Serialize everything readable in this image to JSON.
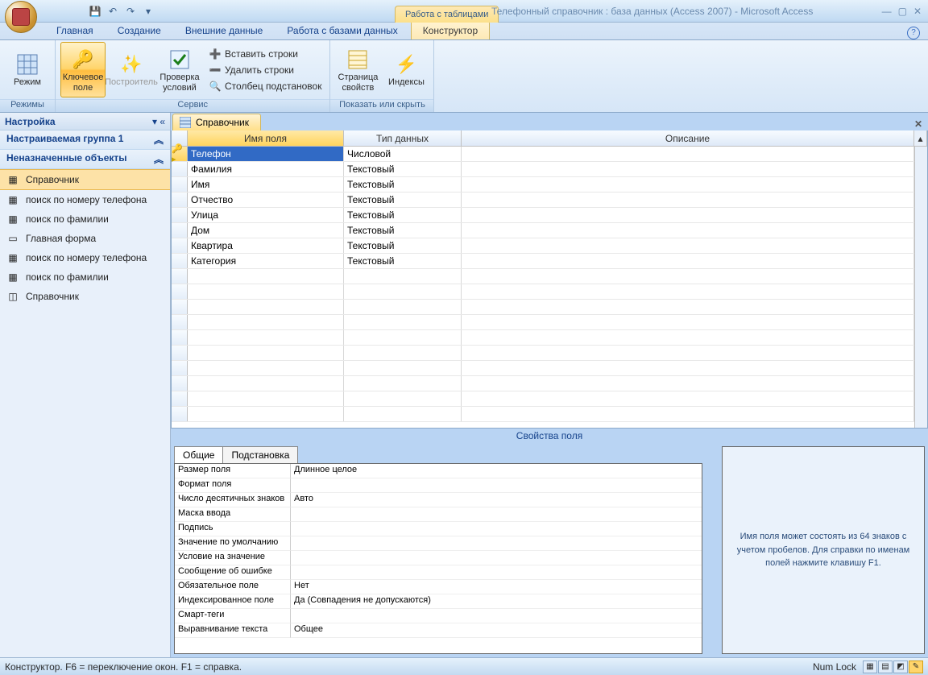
{
  "title": "Телефонный справочник : база данных (Access 2007) - Microsoft Access",
  "context_tab": "Работа с таблицами",
  "ribbon_tabs": [
    "Главная",
    "Создание",
    "Внешние данные",
    "Работа с базами данных",
    "Конструктор"
  ],
  "ribbon_active": "Конструктор",
  "ribbon": {
    "g1": {
      "label": "Режимы",
      "mode": "Режим"
    },
    "g2": {
      "label": "Сервис",
      "key": "Ключевое поле",
      "builder": "Построитель",
      "check": "Проверка условий",
      "ins": "Вставить строки",
      "del": "Удалить строки",
      "col": "Столбец подстановок"
    },
    "g3": {
      "label": "Показать или скрыть",
      "propsheet": "Страница свойств",
      "indexes": "Индексы"
    }
  },
  "nav": {
    "title": "Настройка",
    "grp1": "Настраиваемая группа 1",
    "grp2": "Неназначенные объекты",
    "items": [
      "Справочник",
      "поиск по номеру телефона",
      "поиск по фамилии",
      "Главная форма",
      "поиск по номеру телефона",
      "поиск по фамилии",
      "Справочник"
    ]
  },
  "obj_tab": "Справочник",
  "grid": {
    "col_field": "Имя поля",
    "col_type": "Тип данных",
    "col_desc": "Описание",
    "rows": [
      {
        "key": true,
        "name": "Телефон",
        "type": "Числовой"
      },
      {
        "name": "Фамилия",
        "type": "Текстовый"
      },
      {
        "name": "Имя",
        "type": "Текстовый"
      },
      {
        "name": "Отчество",
        "type": "Текстовый"
      },
      {
        "name": "Улица",
        "type": "Текстовый"
      },
      {
        "name": "Дом",
        "type": "Текстовый"
      },
      {
        "name": "Квартира",
        "type": "Текстовый"
      },
      {
        "name": "Категория",
        "type": "Текстовый"
      }
    ]
  },
  "props_title": "Свойства поля",
  "prop_tabs": [
    "Общие",
    "Подстановка"
  ],
  "props": [
    {
      "l": "Размер поля",
      "v": "Длинное целое"
    },
    {
      "l": "Формат поля",
      "v": ""
    },
    {
      "l": "Число десятичных знаков",
      "v": "Авто"
    },
    {
      "l": "Маска ввода",
      "v": ""
    },
    {
      "l": "Подпись",
      "v": ""
    },
    {
      "l": "Значение по умолчанию",
      "v": ""
    },
    {
      "l": "Условие на значение",
      "v": ""
    },
    {
      "l": "Сообщение об ошибке",
      "v": ""
    },
    {
      "l": "Обязательное поле",
      "v": "Нет"
    },
    {
      "l": "Индексированное поле",
      "v": "Да (Совпадения не допускаются)"
    },
    {
      "l": "Смарт-теги",
      "v": ""
    },
    {
      "l": "Выравнивание текста",
      "v": "Общее"
    }
  ],
  "hint": "Имя поля может состоять из 64 знаков с учетом пробелов.  Для справки по именам полей нажмите клавишу F1.",
  "status_left": "Конструктор.  F6 = переключение окон.  F1 = справка.",
  "status_right": "Num Lock"
}
